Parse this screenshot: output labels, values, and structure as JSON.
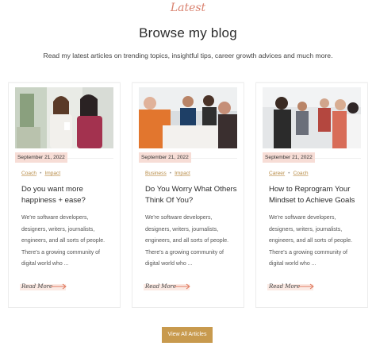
{
  "header": {
    "eyebrow": "Latest",
    "title": "Browse my blog",
    "subtitle": "Read my latest articles on trending topics, insightful tips, career growth advices and much more."
  },
  "posts": [
    {
      "date": "September 21, 2022",
      "tags": [
        "Coach",
        "Impact"
      ],
      "title": "Do you want more happiness + ease?",
      "excerpt": "We're software developers, designers, writers, journalists, engineers, and all sorts of people. There's a growing community of digital world who ...",
      "read_more": "Read More"
    },
    {
      "date": "September 21, 2022",
      "tags": [
        "Business",
        "Impact"
      ],
      "title": "Do You Worry What Others Think Of You?",
      "excerpt": "We're software developers, designers, writers, journalists, engineers, and all sorts of people. There's a growing community of digital world who ...",
      "read_more": "Read More"
    },
    {
      "date": "September 21, 2022",
      "tags": [
        "Career",
        "Coach"
      ],
      "title": "How to Reprogram Your Mindset to Achieve Goals",
      "excerpt": "We're software developers, designers, writers, journalists, engineers, and all sorts of people. There's a growing community of digital world who ...",
      "read_more": "Read More"
    }
  ],
  "view_all_label": "View All Articles",
  "colors": {
    "eyebrow": "#d9826f",
    "accent_button": "#c89a4e",
    "date_badge_bg": "#f7ddd6",
    "tag_text": "#b58a45",
    "arrow": "#e07a5f"
  }
}
